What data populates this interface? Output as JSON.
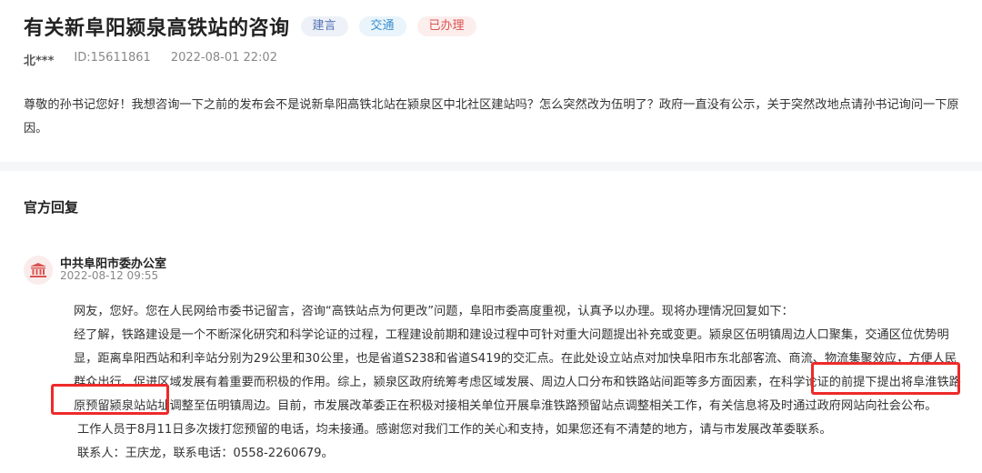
{
  "question": {
    "title": "有关新阜阳颍泉高铁站的咨询",
    "tags": [
      {
        "label": "建言",
        "color": "#5575b8"
      },
      {
        "label": "交通",
        "color": "#3e8fcf"
      },
      {
        "label": "已办理",
        "color": "#d9534f"
      }
    ],
    "user": "北***",
    "id": "ID:15611861",
    "time": "2022-08-01 22:02",
    "body": "尊敬的孙书记您好！我想咨询一下之前的发布会不是说新阜阳高铁北站在颍泉区中北社区建站吗？怎么突然改为伍明了？政府一直没有公示，关于突然改地点请孙书记询问一下原因。"
  },
  "reply": {
    "section_title": "官方回复",
    "org_icon": "government-building-icon",
    "org_name": "中共阜阳市委办公室",
    "time": "2022-08-12 09:55",
    "para1": "网友，您好。您在人民网给市委书记留言，咨询“高铁站点为何更改”问题，阜阳市委高度重视，认真予以办理。现将办理情况回复如下：",
    "para2_part1": "经了解，铁路建设是一个不断深化研究和科学论证的过程，工程建设前期和建设过程中可针对重大问题提出补充或变更。颍泉区伍明镇周边人口聚集，交通区位优势明显，距离阜阳西站和利辛站分别为29公里和30公里，也是省道S238和省道S419的交汇点。在此处设立站点对加快阜阳市东北部客流、商流、物流集聚效应，方便人民群众出行、促进区域发展有着重要而积极的作用。综上，颍泉区政府统筹考虑区域发展、周边人口分布和铁路站间距等多方面因素，在科学论证的前提下提出",
    "para2_highlight": "将阜淮铁路原预留颍泉站站址调整至伍明镇周边",
    "para2_part2": "。目前，市发展改革委正在积极对接相关单位开展阜淮铁路预留站点调整相关工作，有关信息将及时通过政府网站向社会公布。",
    "para3": "工作人员于8月11日多次拨打您预留的电话，均未接通。感谢您对我们工作的关心和支持，如果您还有不清楚的地方，请与市发展改革委联系。",
    "para4": "联系人：王庆龙，联系电话：0558-2260679。"
  },
  "colors": {
    "highlight_box": "#ee2a2a",
    "accent_red": "#d9534f"
  }
}
